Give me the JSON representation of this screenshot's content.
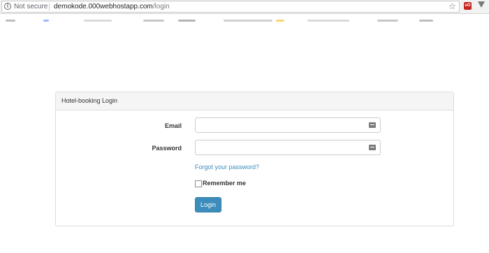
{
  "browser": {
    "security_label": "Not secure",
    "url_host": "demokode.000webhostapp.com",
    "url_path": "/login",
    "extension_label": "uO"
  },
  "panel": {
    "heading": "Hotel-booking Login"
  },
  "form": {
    "email_label": "Email",
    "email_value": "",
    "password_label": "Password",
    "password_value": "",
    "forgot_link": "Forgot your password?",
    "remember_label": "Remember me",
    "remember_checked": false,
    "login_button": "Login"
  },
  "colors": {
    "primary": "#3c8dbc",
    "panel_heading_bg": "#f5f5f5",
    "border": "#dddddd"
  },
  "icons": [
    "info-icon",
    "star-icon",
    "ublock-extension-icon",
    "menu-icon",
    "key-icon"
  ]
}
